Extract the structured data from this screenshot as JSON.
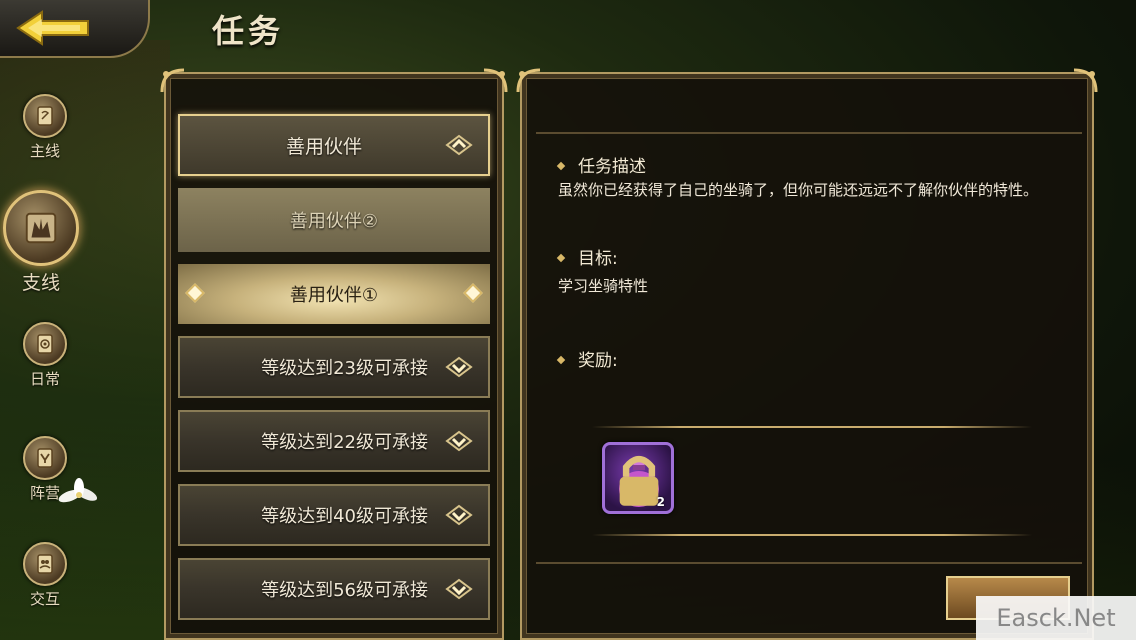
{
  "header": {
    "title": "任务"
  },
  "left_nav": {
    "items": [
      {
        "label": "主线",
        "icon": "scroll-icon",
        "active": false
      },
      {
        "label": "支线",
        "icon": "crown-icon",
        "active": true
      },
      {
        "label": "日常",
        "icon": "target-icon",
        "active": false
      },
      {
        "label": "阵营",
        "icon": "shield-icon",
        "active": false
      },
      {
        "label": "交互",
        "icon": "people-icon",
        "active": false
      }
    ]
  },
  "task_list": {
    "header": "善用伙伴",
    "sub_items": [
      "善用伙伴②",
      "善用伙伴①"
    ],
    "groups": [
      "等级达到23级可承接",
      "等级达到22级可承接",
      "等级达到40级可承接",
      "等级达到56级可承接"
    ]
  },
  "detail": {
    "description_title": "任务描述",
    "description_text": "虽然你已经获得了自己的坐骑了，但你可能还远远不了解你伙伴的特性。",
    "goal_title": "目标:",
    "goal_text": "学习坐骑特性",
    "reward_title": "奖励:",
    "reward_item": {
      "icon": "bag-icon",
      "count": "2",
      "color": "#7b3cb0"
    }
  },
  "watermark": "Easck.Net"
}
